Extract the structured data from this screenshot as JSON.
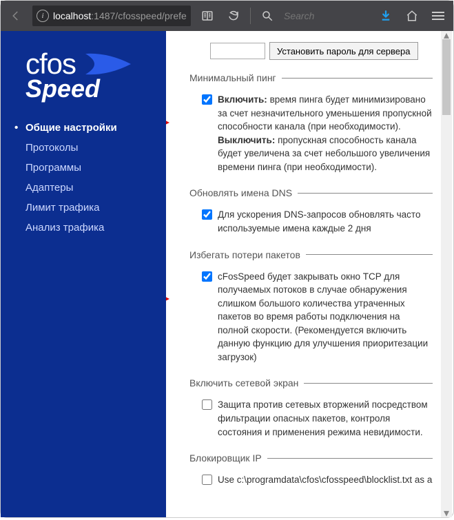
{
  "toolbar": {
    "url_host": "localhost",
    "url_rest": ":1487/cfosspeed/prefe",
    "search_placeholder": "Search"
  },
  "logo": {
    "line1": "cfos",
    "line2": "Speed"
  },
  "sidebar": {
    "items": [
      {
        "label": "Общие настройки",
        "active": true
      },
      {
        "label": "Протоколы"
      },
      {
        "label": "Программы"
      },
      {
        "label": "Адаптеры"
      },
      {
        "label": "Лимит трафика"
      },
      {
        "label": "Анализ трафика"
      }
    ]
  },
  "content": {
    "set_password_button": "Установить пароль для сервера",
    "sections": {
      "min_ping": {
        "legend": "Минимальный пинг",
        "checkbox_checked": true,
        "text_enable_bold": "Включить:",
        "text_enable_rest": " время пинга будет минимизировано за счет незначительного уменьшения пропускной способности канала (при необходимости).",
        "text_disable_bold": "Выключить:",
        "text_disable_rest": " пропускная способность канала будет увеличена за счет небольшого увеличения времени пинга (при необходимости)."
      },
      "dns": {
        "legend": "Обновлять имена DNS",
        "checkbox_checked": true,
        "text": "Для ускорения DNS-запросов обновлять часто используемые имена каждые 2 дня"
      },
      "packet_loss": {
        "legend": "Избегать потери пакетов",
        "checkbox_checked": true,
        "text": "cFosSpeed будет закрывать окно TCP для получаемых потоков в случае обнаружения слишком большого количества утраченных пакетов во время работы подключения на полной скорости. (Рекомендуется включить данную функцию для улучшения приоритезации загрузок)"
      },
      "firewall": {
        "legend": "Включить сетевой экран",
        "checkbox_checked": false,
        "text": "Защита против сетевых вторжений посредством фильтрации опасных пакетов, контроля состояния и применения режима невидимости."
      },
      "blocker": {
        "legend": "Блокировщик IP",
        "checkbox_checked": false,
        "text": "Use c:\\programdata\\cfos\\cfosspeed\\blocklist.txt as a"
      }
    }
  }
}
